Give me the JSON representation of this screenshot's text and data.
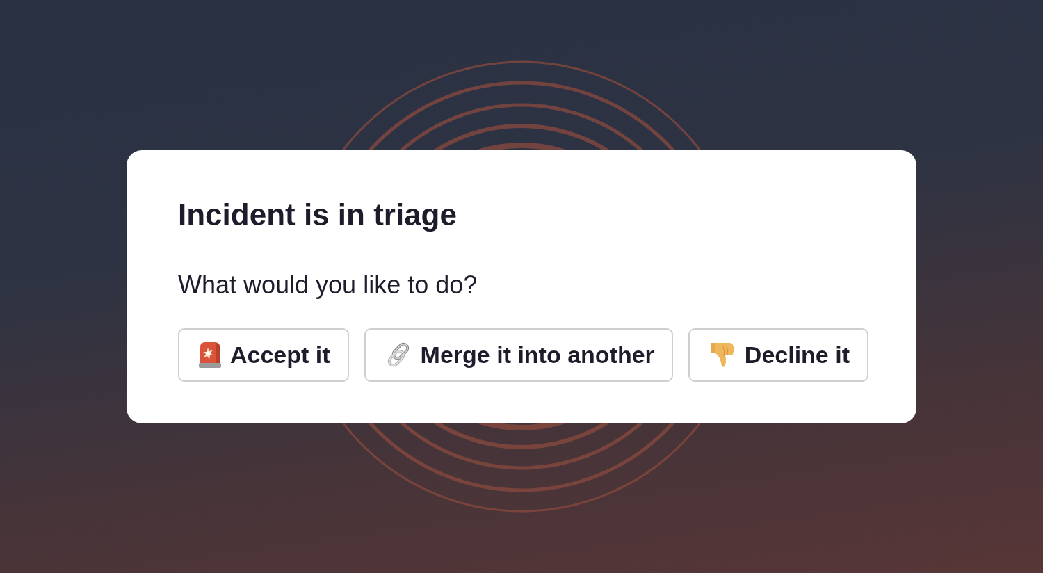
{
  "dialog": {
    "title": "Incident is in triage",
    "prompt": "What would you like to do?",
    "actions": [
      {
        "kind": "accept",
        "label": "Accept it"
      },
      {
        "kind": "merge",
        "label": "Merge it into another"
      },
      {
        "kind": "decline",
        "label": "Decline it"
      }
    ]
  }
}
